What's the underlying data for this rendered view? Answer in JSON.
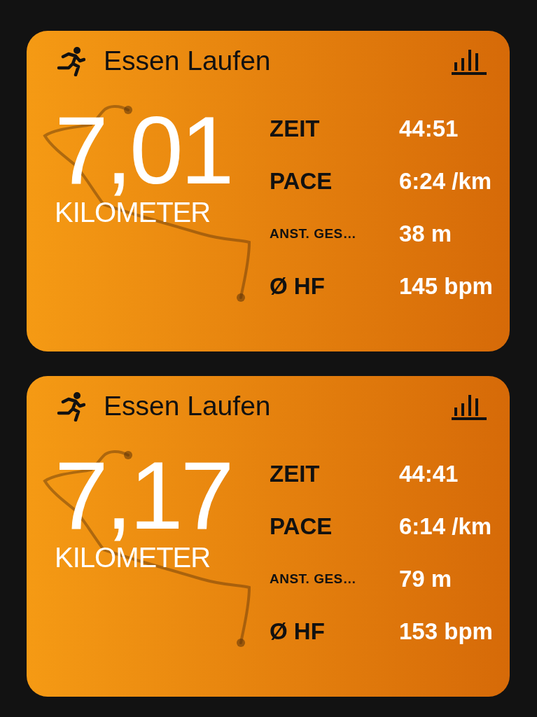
{
  "workouts": [
    {
      "title": "Essen Laufen",
      "distance": "7,01",
      "unit": "KILOMETER",
      "metrics": [
        {
          "kind": "plain",
          "label": "ZEIT",
          "value": "44:51"
        },
        {
          "kind": "plain",
          "label": "PACE",
          "value": "6:24 /km"
        },
        {
          "kind": "abbreviated",
          "label": "ANST. GES…",
          "value": "38 m"
        },
        {
          "kind": "plain",
          "label": "Ø HF",
          "value": "145 bpm"
        }
      ]
    },
    {
      "title": "Essen Laufen",
      "distance": "7,17",
      "unit": "KILOMETER",
      "metrics": [
        {
          "kind": "plain",
          "label": "ZEIT",
          "value": "44:41"
        },
        {
          "kind": "plain",
          "label": "PACE",
          "value": "6:14 /km"
        },
        {
          "kind": "abbreviated",
          "label": "ANST. GES…",
          "value": "79 m"
        },
        {
          "kind": "plain",
          "label": "Ø HF",
          "value": "153 bpm"
        }
      ]
    }
  ]
}
